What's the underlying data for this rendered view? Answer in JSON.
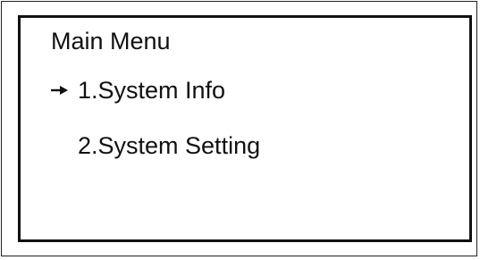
{
  "menu": {
    "title": "Main Menu",
    "selected_index": 0,
    "cursor_icon": "right-arrow-icon",
    "items": [
      {
        "label": "1.System Info"
      },
      {
        "label": "2.System Setting"
      }
    ]
  },
  "colors": {
    "ink": "#111111",
    "background": "#ffffff"
  }
}
